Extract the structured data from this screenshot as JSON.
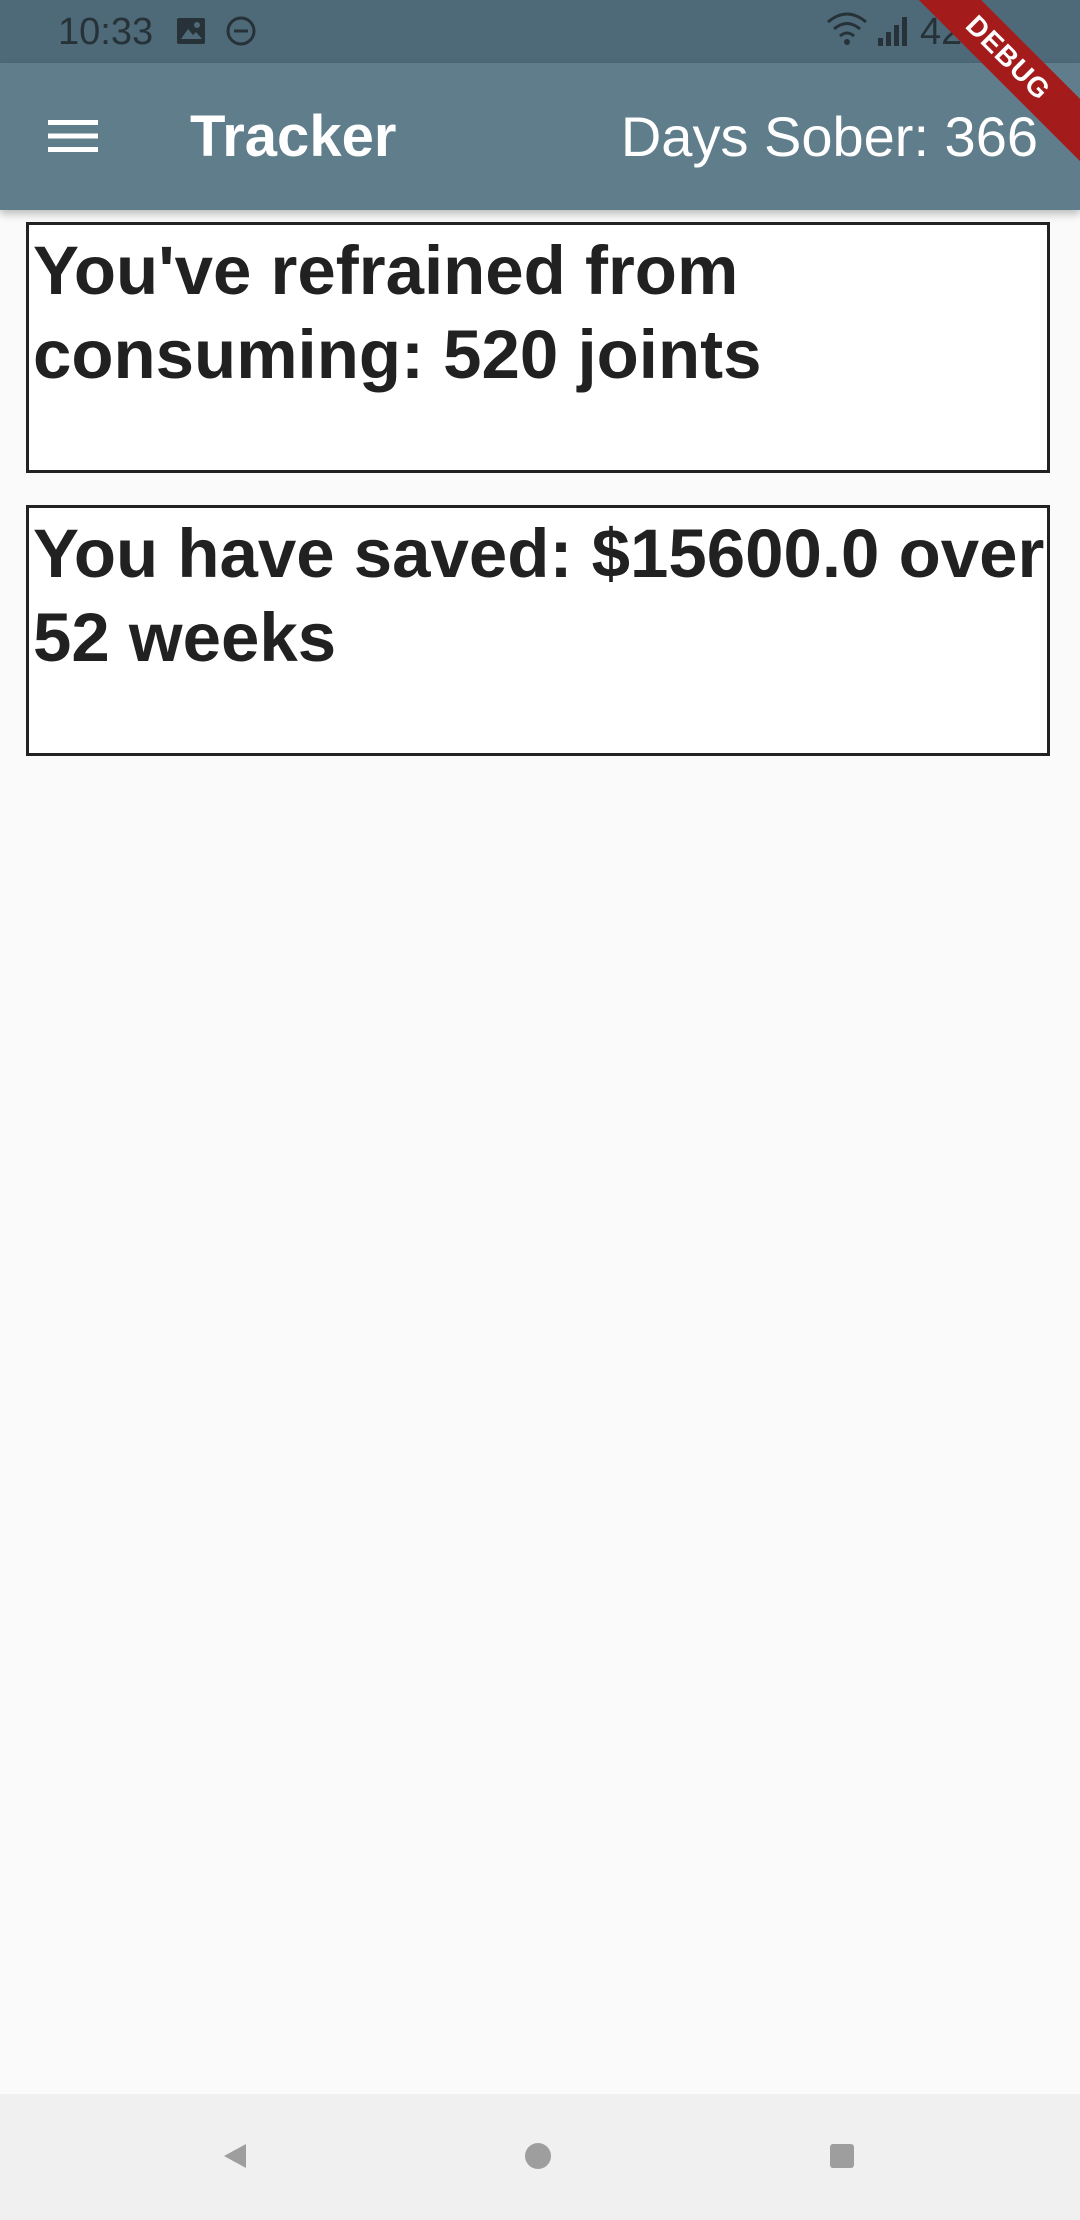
{
  "status_bar": {
    "time": "10:33",
    "battery": "42",
    "icons": [
      "image-icon",
      "dnd-icon",
      "wifi-icon",
      "signal-icon"
    ]
  },
  "app_bar": {
    "title": "Tracker",
    "days_sober": "Days Sober: 366",
    "menu_icon": "hamburger-menu-icon",
    "color": "#607d8b"
  },
  "debug_banner": "DEBUG",
  "cards": [
    {
      "text": "You've refrained from consuming: 520 joints"
    },
    {
      "text": "You have saved: $15600.0 over 52 weeks"
    }
  ],
  "nav_bar": {
    "icons": [
      "back-icon",
      "home-icon",
      "recents-icon"
    ]
  }
}
